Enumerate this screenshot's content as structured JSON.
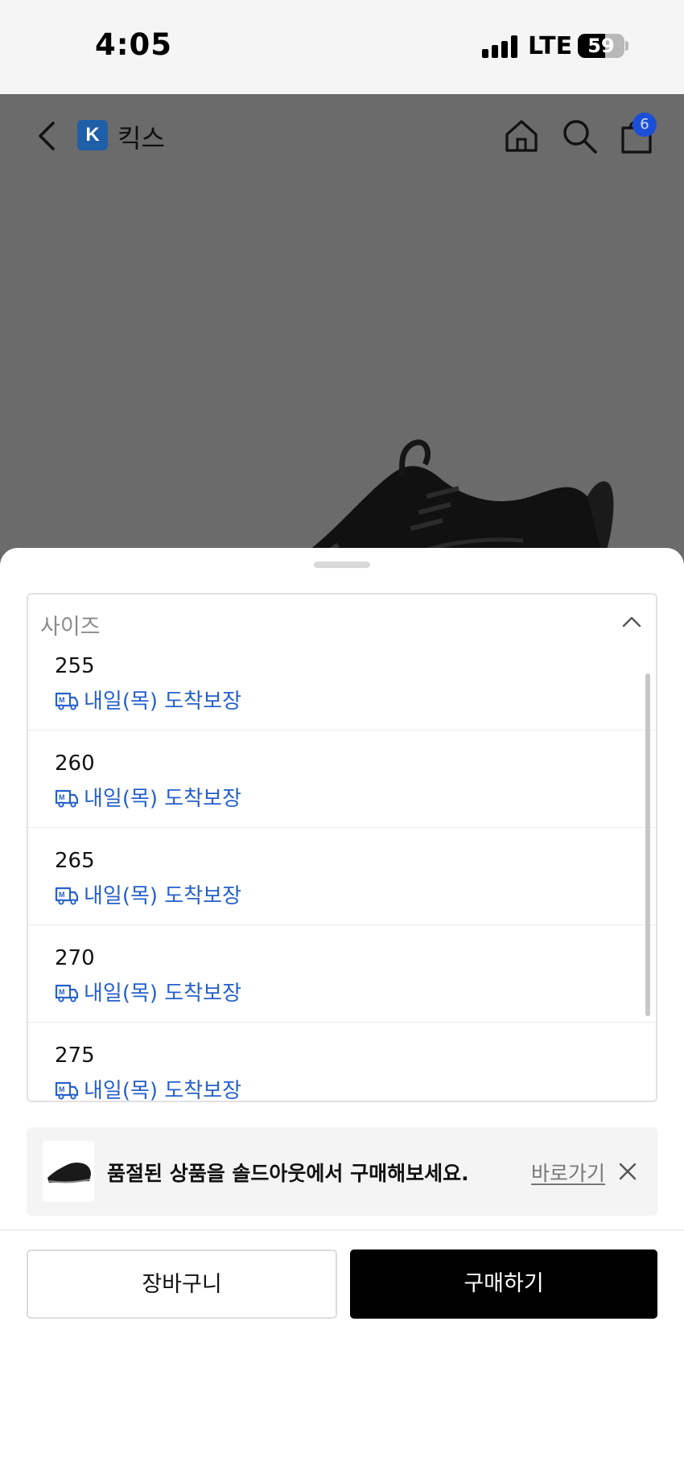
{
  "status_bar": {
    "time": "4:05",
    "network": "LTE",
    "battery": "59",
    "battery_level": 0.59
  },
  "nav": {
    "back_icon": "chevron-left-icon",
    "brand_logo_letter": "K",
    "brand_name": "킥스",
    "home_icon": "home-icon",
    "search_icon": "search-icon",
    "cart_icon": "shopping-bag-icon",
    "cart_count": "6"
  },
  "size_selector": {
    "label": "사이즈",
    "expanded": true,
    "options": [
      {
        "size": "255",
        "delivery": "내일(목) 도착보장"
      },
      {
        "size": "260",
        "delivery": "내일(목) 도착보장"
      },
      {
        "size": "265",
        "delivery": "내일(목) 도착보장"
      },
      {
        "size": "270",
        "delivery": "내일(목) 도착보장"
      },
      {
        "size": "275",
        "delivery": "내일(목) 도착보장"
      }
    ]
  },
  "soldout_banner": {
    "text": "품절된 상품을 솔드아웃에서 구매해보세요.",
    "link": "바로가기"
  },
  "actions": {
    "cart_label": "장바구니",
    "buy_label": "구매하기"
  },
  "colors": {
    "accent_blue": "#2660cc",
    "badge_blue": "#1c4fd8",
    "buy_button": "#000000"
  }
}
